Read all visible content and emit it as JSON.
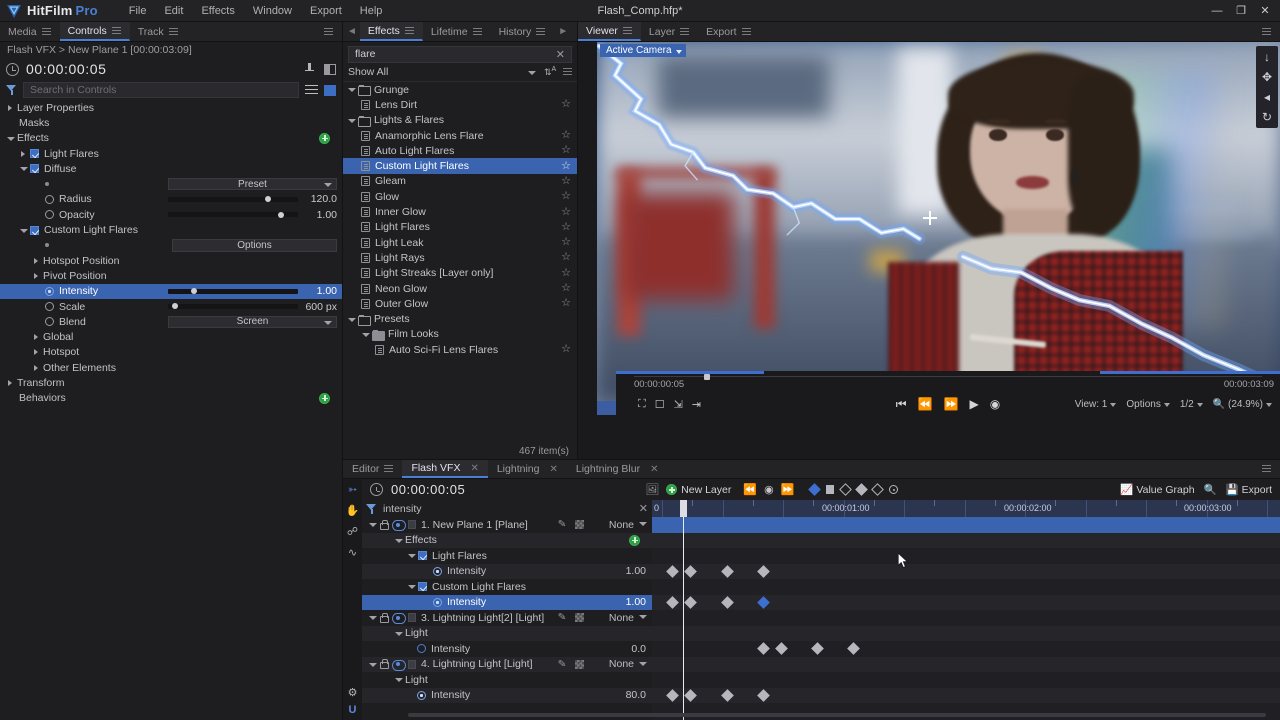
{
  "app": {
    "brand": "HitFilm",
    "brand_suffix": "Pro",
    "window_title": "Flash_Comp.hfp*",
    "menus": [
      "File",
      "Edit",
      "Effects",
      "Window",
      "Export",
      "Help"
    ],
    "window_buttons": [
      "—",
      "❐",
      "✕"
    ]
  },
  "controls_panel": {
    "tabs": [
      {
        "label": "Media",
        "active": false
      },
      {
        "label": "Controls",
        "active": true
      },
      {
        "label": "Track",
        "active": false
      }
    ],
    "breadcrumb": "Flash VFX > New Plane 1 [00:00:03:09]",
    "timecode": "00:00:00:05",
    "search_placeholder": "Search in Controls",
    "search_value": "",
    "tree": [
      {
        "id": "layer-properties",
        "label": "Layer Properties",
        "indent": 0,
        "tri": "closed"
      },
      {
        "id": "masks",
        "label": "Masks",
        "indent": 1,
        "tri": "none"
      },
      {
        "id": "effects",
        "label": "Effects",
        "indent": 0,
        "tri": "open",
        "add": true
      },
      {
        "id": "light-flares",
        "label": "Light Flares",
        "indent": 1,
        "tri": "closed",
        "check": true
      },
      {
        "id": "diffuse",
        "label": "Diffuse",
        "indent": 1,
        "tri": "open",
        "check": true
      },
      {
        "id": "preset",
        "label": "",
        "indent": 3,
        "widget": "combo",
        "combo_value": "Preset",
        "bullet": true
      },
      {
        "id": "radius",
        "label": "Radius",
        "indent": 3,
        "widget": "slider",
        "value": "120.0",
        "knob": 0.77,
        "kf": "dot"
      },
      {
        "id": "opacity",
        "label": "Opacity",
        "indent": 3,
        "widget": "slider",
        "value": "1.00",
        "knob": 0.87,
        "kf": "dot"
      },
      {
        "id": "custom-light-flares",
        "label": "Custom Light Flares",
        "indent": 1,
        "tri": "open",
        "check": true
      },
      {
        "id": "options",
        "label": "",
        "indent": 3,
        "widget": "button",
        "combo_value": "Options",
        "bullet": true,
        "half": true
      },
      {
        "id": "hotspot-position",
        "label": "Hotspot Position",
        "indent": 2,
        "tri": "closed"
      },
      {
        "id": "pivot-position",
        "label": "Pivot Position",
        "indent": 2,
        "tri": "closed"
      },
      {
        "id": "intensity",
        "label": "Intensity",
        "indent": 3,
        "widget": "slider",
        "value": "1.00",
        "knob": 0.2,
        "kf": "active",
        "selected": true
      },
      {
        "id": "scale",
        "label": "Scale",
        "indent": 3,
        "widget": "slider",
        "value": "600 px",
        "knob": 0.05,
        "kf": "dot"
      },
      {
        "id": "blend",
        "label": "Blend",
        "indent": 3,
        "widget": "combo",
        "combo_value": "Screen",
        "kf": "dot"
      },
      {
        "id": "global",
        "label": "Global",
        "indent": 2,
        "tri": "closed"
      },
      {
        "id": "hotspot",
        "label": "Hotspot",
        "indent": 2,
        "tri": "closed"
      },
      {
        "id": "other-elements",
        "label": "Other Elements",
        "indent": 2,
        "tri": "closed"
      },
      {
        "id": "transform",
        "label": "Transform",
        "indent": 0,
        "tri": "closed"
      },
      {
        "id": "behaviors",
        "label": "Behaviors",
        "indent": 1,
        "tri": "none",
        "add": true
      }
    ]
  },
  "effects_panel": {
    "tabs": [
      {
        "label": "Effects",
        "active": true
      },
      {
        "label": "Lifetime",
        "active": false
      },
      {
        "label": "History",
        "active": false
      }
    ],
    "search_value": "flare",
    "search_clear": "✕",
    "filter_label": "Show All",
    "item_count": "467 item(s)",
    "tree": [
      {
        "label": "Grunge",
        "type": "folder",
        "indent": 0,
        "tri": "open"
      },
      {
        "label": "Lens Dirt",
        "type": "file",
        "indent": 1,
        "star": true
      },
      {
        "label": "Lights & Flares",
        "type": "folder",
        "indent": 0,
        "tri": "open"
      },
      {
        "label": "Anamorphic Lens Flare",
        "type": "file",
        "indent": 1,
        "star": true
      },
      {
        "label": "Auto Light Flares",
        "type": "file",
        "indent": 1,
        "star": true
      },
      {
        "label": "Custom Light Flares",
        "type": "file",
        "indent": 1,
        "star": true,
        "selected": true
      },
      {
        "label": "Gleam",
        "type": "file",
        "indent": 1,
        "star": true
      },
      {
        "label": "Glow",
        "type": "file",
        "indent": 1,
        "star": true
      },
      {
        "label": "Inner Glow",
        "type": "file",
        "indent": 1,
        "star": true
      },
      {
        "label": "Light Flares",
        "type": "file",
        "indent": 1,
        "star": true
      },
      {
        "label": "Light Leak",
        "type": "file",
        "indent": 1,
        "star": true
      },
      {
        "label": "Light Rays",
        "type": "file",
        "indent": 1,
        "star": true
      },
      {
        "label": "Light Streaks [Layer only]",
        "type": "file",
        "indent": 1,
        "star": true
      },
      {
        "label": "Neon Glow",
        "type": "file",
        "indent": 1,
        "star": true
      },
      {
        "label": "Outer Glow",
        "type": "file",
        "indent": 1,
        "star": true
      },
      {
        "label": "Presets",
        "type": "folder",
        "indent": 0,
        "tri": "open"
      },
      {
        "label": "Film Looks",
        "type": "folder-solid",
        "indent": 1,
        "tri": "open"
      },
      {
        "label": "Auto Sci-Fi Lens Flares",
        "type": "file",
        "indent": 2,
        "star": true
      }
    ]
  },
  "viewer": {
    "tabs": [
      {
        "label": "Viewer",
        "active": true
      },
      {
        "label": "Layer",
        "active": false
      },
      {
        "label": "Export",
        "active": false
      }
    ],
    "camera_label": "Active Camera",
    "current_time": "00:00:00:05",
    "duration": "00:00:03:09",
    "view_label": "View: 1",
    "options_label": "Options",
    "quality_label": "1/2",
    "zoom_label": "(24.9%)",
    "tool_icons": [
      "select-tool",
      "hand-tool",
      "text-tool",
      "rect-tool",
      "pen-tool",
      "orbit-tool"
    ],
    "right_icons": [
      "snap-icon",
      "move-icon",
      "orbit-icon",
      "rotate-icon"
    ]
  },
  "timeline": {
    "tabs": [
      {
        "label": "Editor",
        "active": false,
        "close": false
      },
      {
        "label": "Flash VFX",
        "active": true,
        "close": true
      },
      {
        "label": "Lightning",
        "active": false,
        "close": true
      },
      {
        "label": "Lightning Blur",
        "active": false,
        "close": true
      }
    ],
    "timecode": "00:00:00:05",
    "new_layer_label": "New Layer",
    "filter_value": "intensity",
    "filter_clear": "✕",
    "value_graph_label": "Value Graph",
    "export_label": "Export",
    "ruler_labels": [
      "0",
      "00:00:01:00",
      "00:00:02:00",
      "00:00:03:00"
    ],
    "rows": [
      {
        "kind": "layer",
        "name": "1. New Plane 1 [Plane]",
        "parent": "None",
        "indent": 0,
        "tri": "open",
        "bar": true,
        "keyframes": []
      },
      {
        "kind": "group",
        "name": "Effects",
        "indent": 1,
        "tri": "open",
        "add": true,
        "keyframes": []
      },
      {
        "kind": "effect",
        "name": "Light Flares",
        "indent": 2,
        "tri": "open",
        "check": true,
        "keyframes": []
      },
      {
        "kind": "prop",
        "name": "Intensity",
        "indent": 3,
        "value": "1.00",
        "kf": "active",
        "keyframes": [
          672,
          690,
          727,
          763
        ]
      },
      {
        "kind": "effect",
        "name": "Custom Light Flares",
        "indent": 2,
        "tri": "open",
        "check": true,
        "keyframes": []
      },
      {
        "kind": "prop",
        "name": "Intensity",
        "indent": 3,
        "value": "1.00",
        "kf": "active",
        "selected": true,
        "keyframes": [
          672,
          690,
          727
        ],
        "keyframes_blue": [
          763
        ]
      },
      {
        "kind": "layer",
        "name": "3. Lightning Light[2] [Light]",
        "parent": "None",
        "indent": 0,
        "tri": "open",
        "keyframes": []
      },
      {
        "kind": "group",
        "name": "Light",
        "indent": 1,
        "tri": "open",
        "keyframes": []
      },
      {
        "kind": "prop",
        "name": "Intensity",
        "indent": 2,
        "value": "0.0",
        "kf": "ring",
        "keyframes": [
          763,
          781,
          817,
          853
        ]
      },
      {
        "kind": "layer",
        "name": "4. Lightning Light [Light]",
        "parent": "None",
        "indent": 0,
        "tri": "open",
        "keyframes": []
      },
      {
        "kind": "group",
        "name": "Light",
        "indent": 1,
        "tri": "open",
        "keyframes": []
      },
      {
        "kind": "prop",
        "name": "Intensity",
        "indent": 2,
        "value": "80.0",
        "kf": "active",
        "keyframes": [
          672,
          690,
          727,
          763
        ]
      }
    ]
  },
  "colors": {
    "accent_blue": "#3a64b0",
    "brand_blue": "#4a7fd4",
    "panel_bg": "#1e1e21",
    "titlebar_bg": "#232326",
    "green_add": "#2f9e44"
  }
}
